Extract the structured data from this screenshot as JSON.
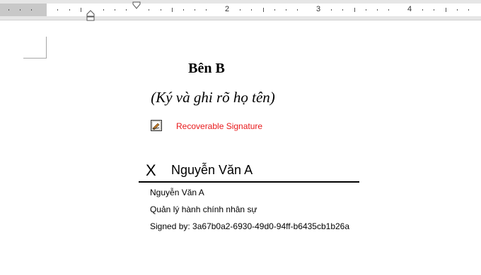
{
  "ruler": {
    "numbers": [
      "1",
      "2",
      "3",
      "4"
    ]
  },
  "document": {
    "title": "Bên B",
    "subtitle": "(Ký và ghi rõ họ tên)",
    "signature": {
      "status_label": "Recoverable Signature",
      "x_mark": "X",
      "signed_name": "Nguyễn Văn A",
      "signer_name": "Nguyễn Văn A",
      "signer_title": "Quản lý hành chính nhân sự",
      "signed_by": "Signed by: 3a67b0a2-6930-49d0-94ff-b6435cb1b26a"
    }
  },
  "colors": {
    "recoverable_text": "#e8191b"
  }
}
